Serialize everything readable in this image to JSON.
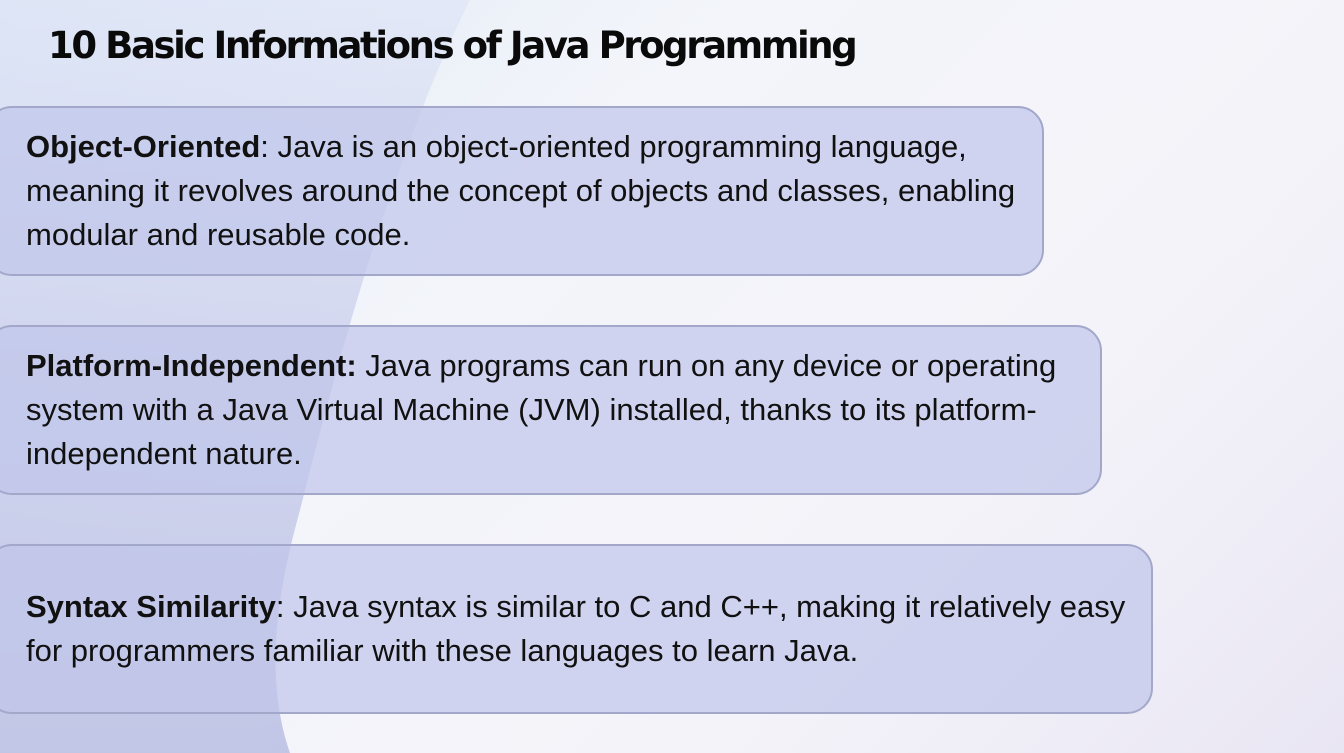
{
  "slide": {
    "title": "10 Basic Informations of Java Programming"
  },
  "cards": [
    {
      "term": "Object-Oriented",
      "separator": ":",
      "description": " Java is an object-oriented programming language, meaning it revolves around the concept of objects and classes, enabling modular and reusable code."
    },
    {
      "term": "Platform-Independent:",
      "separator": "",
      "description": " Java programs can run on any device or operating system with a Java Virtual Machine (JVM) installed, thanks to its platform-independent nature."
    },
    {
      "term": "Syntax Similarity",
      "separator": ":",
      "description": " Java syntax is similar to C and C++, making it relatively easy for programmers familiar with these languages to learn Java."
    }
  ],
  "colors": {
    "card_fill": "#c1c6ea",
    "card_border": "#a3a8cb",
    "background_swoosh": "#bfc4e6",
    "text": "#111111"
  }
}
